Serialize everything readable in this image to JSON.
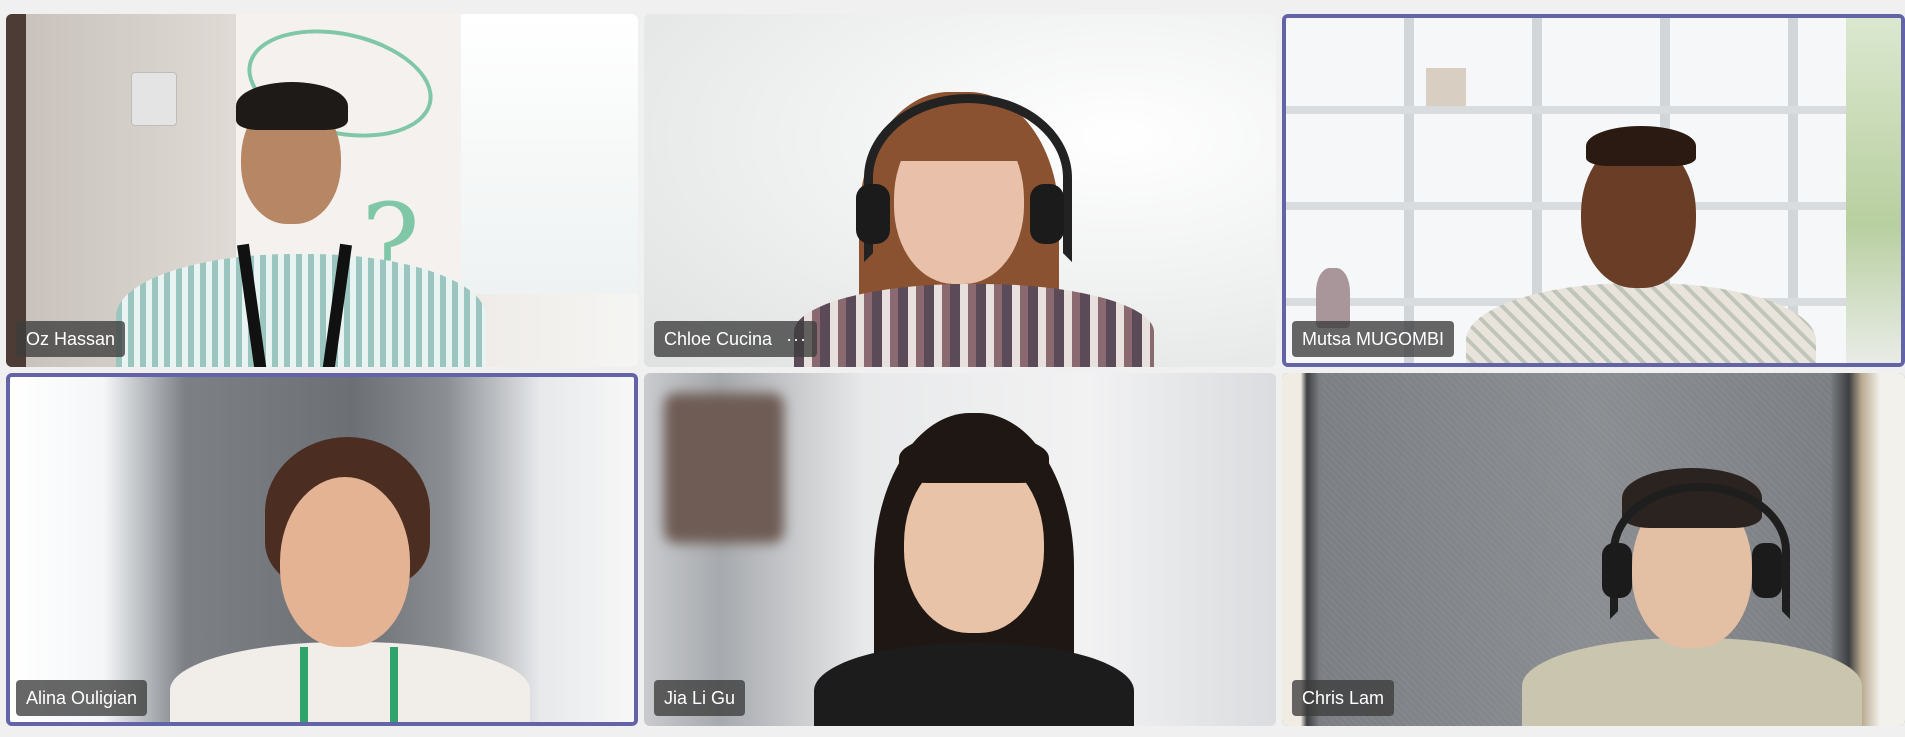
{
  "participants": [
    {
      "name": "Oz Hassan",
      "active": false,
      "has_more_menu": false
    },
    {
      "name": "Chloe Cucina",
      "active": false,
      "has_more_menu": true,
      "more_label": "···"
    },
    {
      "name": "Mutsa MUGOMBI",
      "active": true,
      "has_more_menu": false
    },
    {
      "name": "Alina Ouligian",
      "active": true,
      "has_more_menu": false
    },
    {
      "name": "Jia Li Gu",
      "active": false,
      "has_more_menu": false
    },
    {
      "name": "Chris Lam",
      "active": false,
      "has_more_menu": false
    }
  ],
  "colors": {
    "active_border": "#6264a7",
    "name_chip_bg": "#3c3c3c",
    "page_bg": "#f0f0f0"
  },
  "icons": {
    "more_options": "more-options-icon"
  }
}
